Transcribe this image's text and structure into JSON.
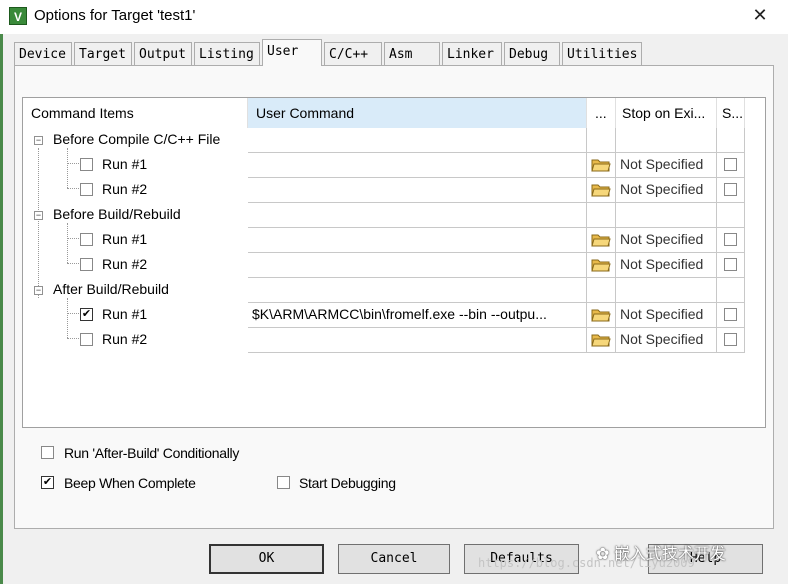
{
  "window": {
    "title": "Options for Target 'test1'",
    "icon_name": "keil-uvision-icon",
    "close_glyph": "✕"
  },
  "tabs": [
    {
      "label": "Device"
    },
    {
      "label": "Target"
    },
    {
      "label": "Output"
    },
    {
      "label": "Listing"
    },
    {
      "label": "User",
      "selected": true
    },
    {
      "label": "C/C++"
    },
    {
      "label": "Asm"
    },
    {
      "label": "Linker"
    },
    {
      "label": "Debug"
    },
    {
      "label": "Utilities"
    }
  ],
  "grid": {
    "headers": {
      "items": "Command Items",
      "command": "User Command",
      "browse": "...",
      "stop": "Stop on Exi...",
      "s": "S..."
    },
    "groups": [
      {
        "label": "Before Compile C/C++ File",
        "runs": [
          {
            "label": "Run #1",
            "checked": false,
            "command": "",
            "stop": "Not Specified"
          },
          {
            "label": "Run #2",
            "checked": false,
            "command": "",
            "stop": "Not Specified"
          }
        ]
      },
      {
        "label": "Before Build/Rebuild",
        "runs": [
          {
            "label": "Run #1",
            "checked": false,
            "command": "",
            "stop": "Not Specified"
          },
          {
            "label": "Run #2",
            "checked": false,
            "command": "",
            "stop": "Not Specified"
          }
        ]
      },
      {
        "label": "After Build/Rebuild",
        "runs": [
          {
            "label": "Run #1",
            "checked": true,
            "command": "$K\\ARM\\ARMCC\\bin\\fromelf.exe --bin --outpu...",
            "stop": "Not Specified"
          },
          {
            "label": "Run #2",
            "checked": false,
            "command": "",
            "stop": "Not Specified"
          }
        ]
      }
    ],
    "expander_glyph": "−",
    "check_glyph": "✔",
    "folder_icon": "folder-open-icon"
  },
  "options": {
    "run_after_build": {
      "label": "Run 'After-Build' Conditionally",
      "checked": false
    },
    "beep": {
      "label": "Beep When Complete",
      "checked": true
    },
    "start_debugging": {
      "label": "Start Debugging",
      "checked": false
    }
  },
  "buttons": {
    "ok": "OK",
    "cancel": "Cancel",
    "defaults": "Defaults",
    "help": "Help"
  },
  "overlay": {
    "watermark": "https://blog.csdn.net/liyu2009",
    "wechat_glyph": "✿",
    "wechat_account": "嵌入式技术开发"
  },
  "colors": {
    "selected_header": "#d9ebf9",
    "panel": "#f9f9f9",
    "window": "#f0f0f0"
  }
}
